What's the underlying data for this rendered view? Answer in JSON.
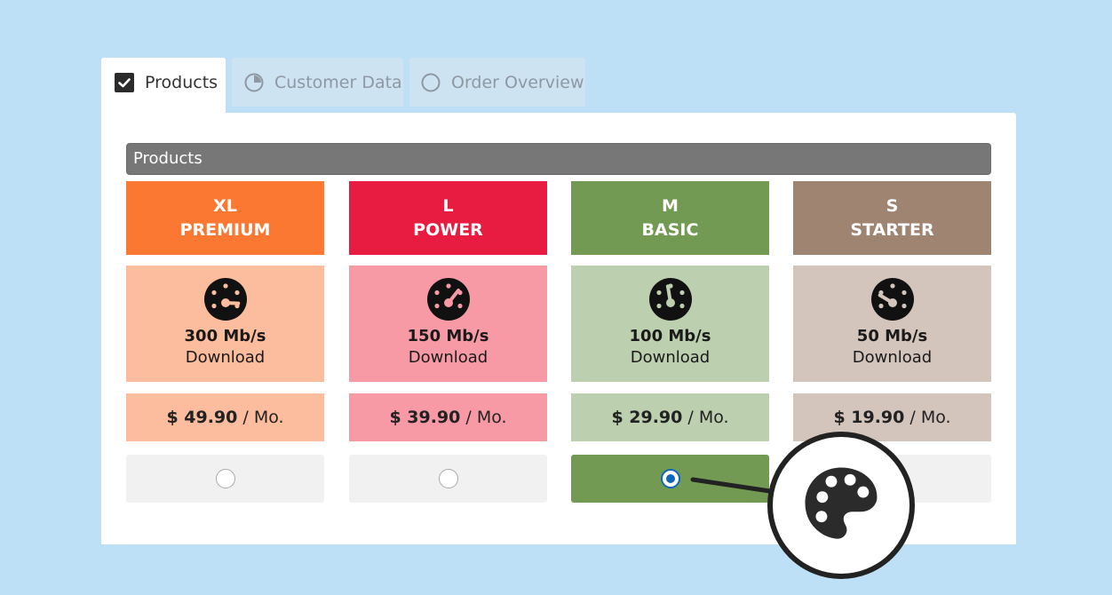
{
  "tabs": [
    {
      "label": "Products",
      "icon": "checkbox-checked-icon",
      "active": true
    },
    {
      "label": "Customer Data",
      "icon": "pie-progress-icon",
      "active": false
    },
    {
      "label": "Order Overview",
      "icon": "circle-icon",
      "active": false
    }
  ],
  "section": {
    "title": "Products"
  },
  "products": [
    {
      "size": "XL",
      "name": "PREMIUM",
      "speed": "300 Mb/s",
      "speed_label": "Download",
      "price": "$ 49.90",
      "period": "/ Mo.",
      "selected": false,
      "colors": {
        "head": "#fb7832",
        "body": "#fcbc9e"
      },
      "gauge_level": 0.95
    },
    {
      "size": "L",
      "name": "POWER",
      "speed": "150 Mb/s",
      "speed_label": "Download",
      "price": "$ 39.90",
      "period": "/ Mo.",
      "selected": false,
      "colors": {
        "head": "#e81c41",
        "body": "#f79aa5"
      },
      "gauge_level": 0.7
    },
    {
      "size": "M",
      "name": "BASIC",
      "speed": "100 Mb/s",
      "speed_label": "Download",
      "price": "$ 29.90",
      "period": "/ Mo.",
      "selected": true,
      "colors": {
        "head": "#739a52",
        "body": "#bccfae"
      },
      "gauge_level": 0.45
    },
    {
      "size": "S",
      "name": "STARTER",
      "speed": "50 Mb/s",
      "speed_label": "Download",
      "price": "$ 19.90",
      "period": "/ Mo.",
      "selected": false,
      "colors": {
        "head": "#a08472",
        "body": "#d3c5bc"
      },
      "gauge_level": 0.2
    }
  ],
  "badge": {
    "icon": "palette-icon"
  }
}
